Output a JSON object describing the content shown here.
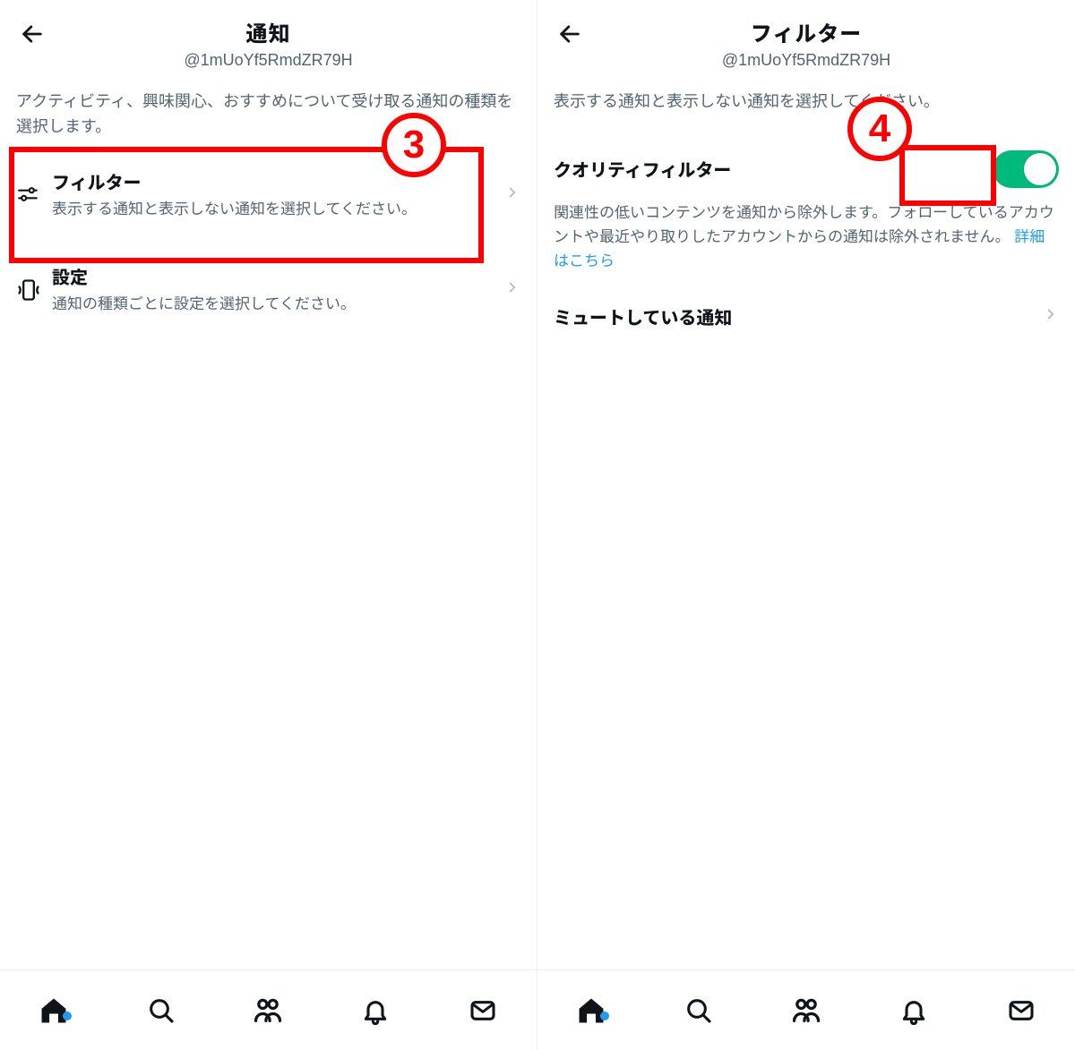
{
  "left": {
    "header": {
      "title": "通知",
      "handle": "@1mUoYf5RmdZR79H"
    },
    "intro": "アクティビティ、興味関心、おすすめについて受け取る通知の種類を選択します。",
    "items": [
      {
        "icon": "sliders-icon",
        "title": "フィルター",
        "sub": "表示する通知と表示しない通知を選択してください。"
      },
      {
        "icon": "phone-vibrate-icon",
        "title": "設定",
        "sub": "通知の種類ごとに設定を選択してください。"
      }
    ]
  },
  "right": {
    "header": {
      "title": "フィルター",
      "handle": "@1mUoYf5RmdZR79H"
    },
    "intro": "表示する通知と表示しない通知を選択してください。",
    "quality": {
      "title": "クオリティフィルター",
      "on": true,
      "desc": "関連性の低いコンテンツを通知から除外します。フォローしているアカウントや最近やり取りしたアカウントからの通知は除外されません。",
      "link": "詳細はこちら"
    },
    "mute": {
      "title": "ミュートしている通知"
    }
  },
  "nav": {
    "tabs": [
      "home-icon",
      "search-icon",
      "people-icon",
      "bell-icon",
      "mail-icon"
    ],
    "active": 0,
    "has_dot": true
  },
  "annotations": {
    "a3": "3",
    "a4": "4"
  }
}
